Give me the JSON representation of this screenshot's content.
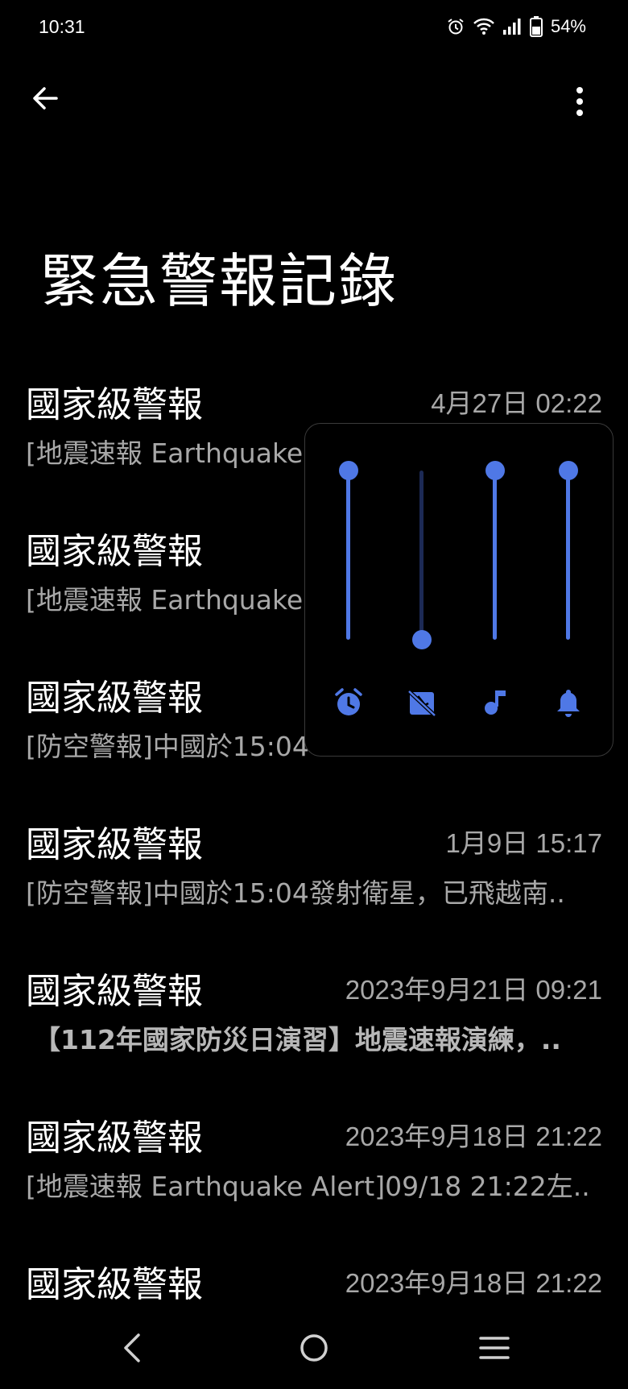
{
  "status_bar": {
    "time": "10:31",
    "battery": "54%",
    "icons": [
      "alarm-icon",
      "wifi-icon",
      "signal-icon",
      "battery-icon"
    ]
  },
  "app_bar": {
    "back_icon": "arrow-left-icon",
    "menu_icon": "more-vert-icon"
  },
  "page": {
    "title": "緊急警報記錄"
  },
  "alerts": [
    {
      "title": "國家級警報",
      "time": "4月27日 02:22",
      "body": "[地震速報 Earthquake",
      "bold": false
    },
    {
      "title": "國家級警報",
      "time": "",
      "body": "[地震速報 Earthquake",
      "bold": false
    },
    {
      "title": "國家級警報",
      "time": "",
      "body": "[防空警報]中國於15:04",
      "bold": false
    },
    {
      "title": "國家級警報",
      "time": "1月9日 15:17",
      "body": "[防空警報]中國於15:04發射衛星，已飛越南..",
      "bold": false
    },
    {
      "title": "國家級警報",
      "time": "2023年9月21日 09:21",
      "body": "【112年國家防災日演習】地震速報演練，..",
      "bold": true
    },
    {
      "title": "國家級警報",
      "time": "2023年9月18日 21:22",
      "body": "[地震速報 Earthquake Alert]09/18 21:22左..",
      "bold": false
    },
    {
      "title": "國家級警報",
      "time": "2023年9月18日 21:22",
      "body": "",
      "bold": false
    }
  ],
  "volume_panel": {
    "accent_color": "#4f78e6",
    "sliders": [
      {
        "name": "alarm",
        "icon": "alarm-clock-icon",
        "level": 1.0
      },
      {
        "name": "call",
        "icon": "call-muted-icon",
        "level": 0.0
      },
      {
        "name": "media",
        "icon": "music-note-icon",
        "level": 1.0
      },
      {
        "name": "ring",
        "icon": "bell-icon",
        "level": 1.0
      }
    ]
  },
  "nav_bar": {
    "icons": [
      "nav-back-icon",
      "nav-home-icon",
      "nav-recents-icon"
    ]
  }
}
